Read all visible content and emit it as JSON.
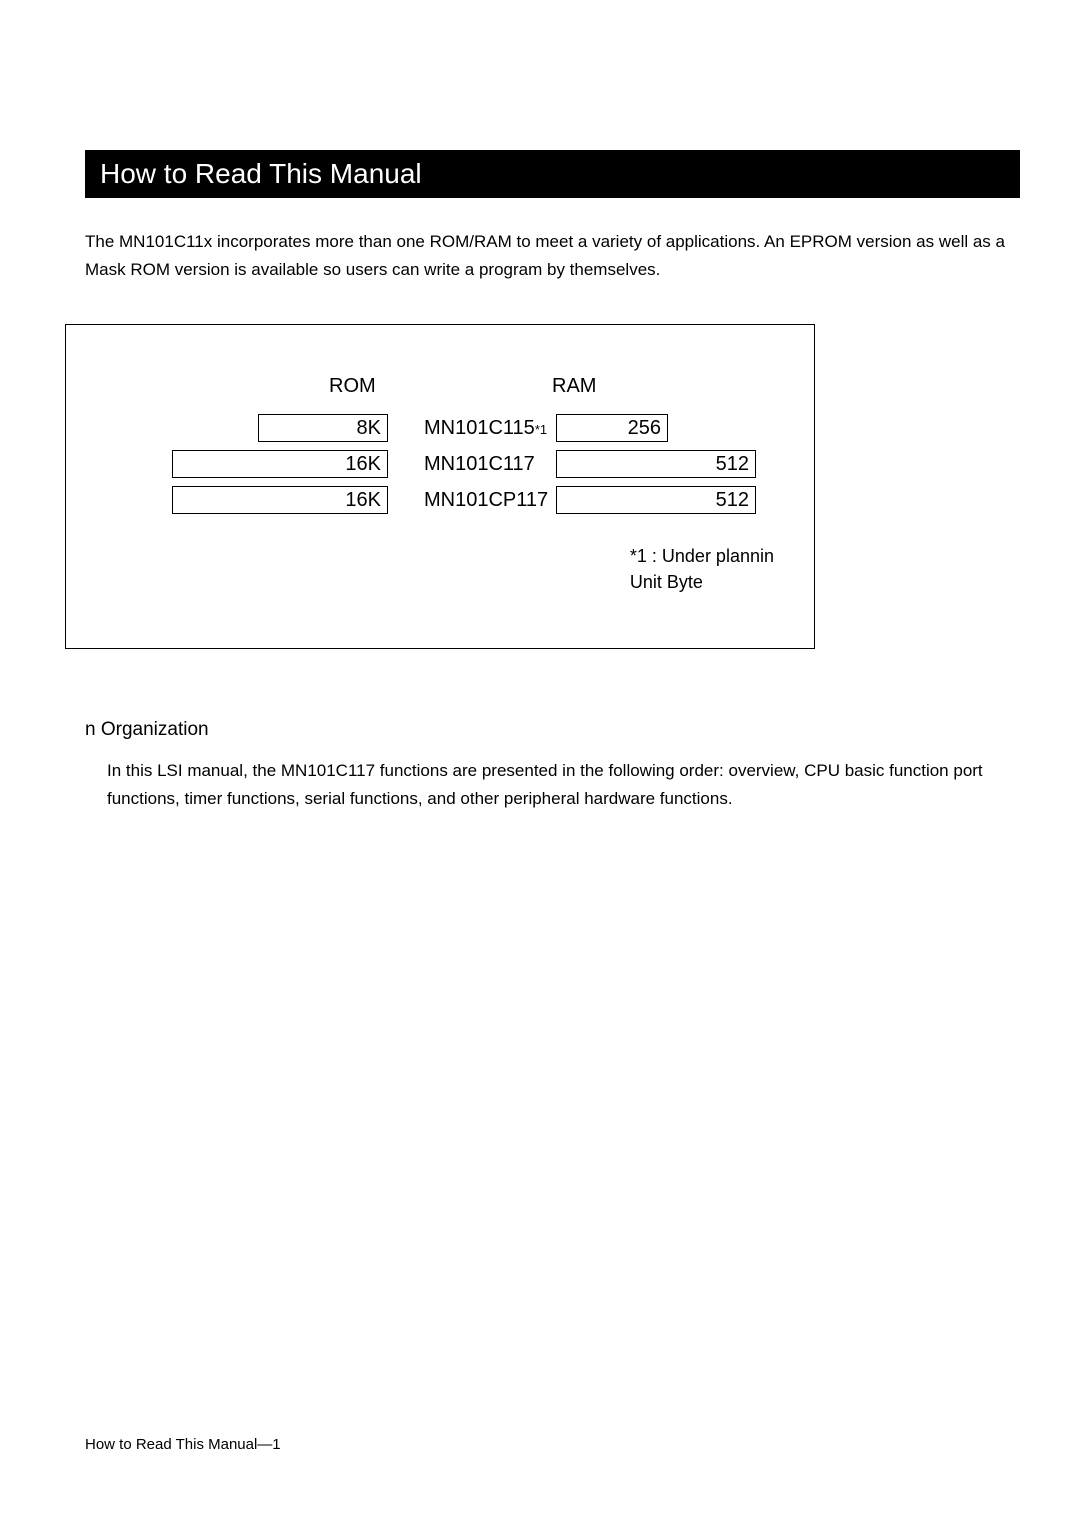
{
  "title": "How to Read This Manual",
  "intro": "The MN101C11x incorporates more than one ROM/RAM to meet a variety of applications. An EPROM version as well as a Mask ROM version is available so users can write a program by themselves.",
  "diagram": {
    "rom_label": "ROM",
    "ram_label": "RAM",
    "rows": [
      {
        "rom": "8K",
        "part": "MN101C115",
        "note": "*1",
        "ram": "256"
      },
      {
        "rom": "16K",
        "part": "MN101C117",
        "note": "",
        "ram": "512"
      },
      {
        "rom": "16K",
        "part": "MN101CP117",
        "note": "",
        "ram": "512"
      }
    ],
    "footnote1": "*1 :  Under plannin",
    "footnote2": "Unit   Byte"
  },
  "section": {
    "heading": "n  Organization",
    "body": "In this LSI manual, the MN101C117 functions are presented in the following order: overview, CPU basic function port functions, timer functions, serial functions, and other peripheral hardware functions."
  },
  "footer": "How to Read This Manual—1"
}
